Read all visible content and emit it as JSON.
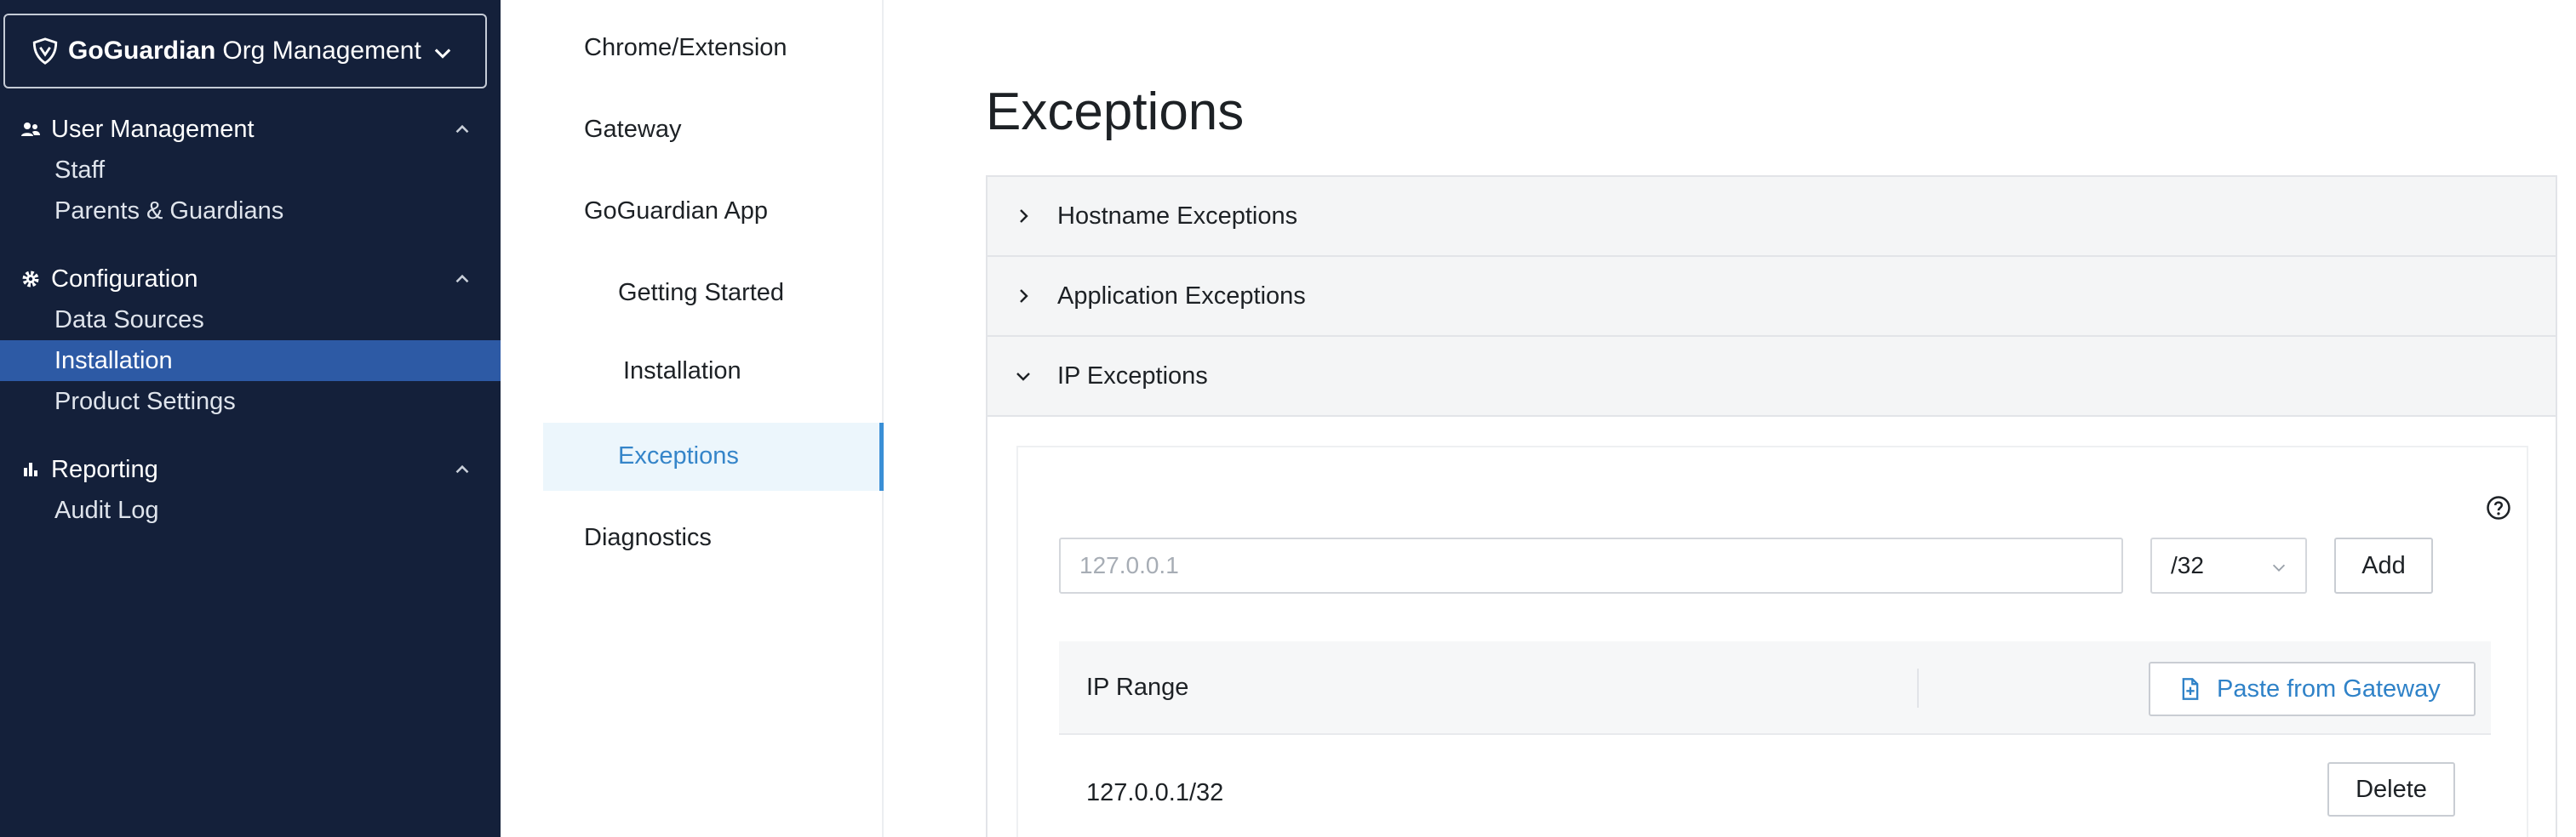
{
  "sidebar": {
    "org_brand": "GoGuardian",
    "org_name": "Org Management",
    "sections": [
      {
        "label": "User Management",
        "items": [
          "Staff",
          "Parents & Guardians"
        ]
      },
      {
        "label": "Configuration",
        "items": [
          "Data Sources",
          "Installation",
          "Product Settings"
        ],
        "active_item": "Installation"
      },
      {
        "label": "Reporting",
        "items": [
          "Audit Log"
        ]
      }
    ],
    "colors": {
      "background": "#14203a",
      "active": "#2d5aa5"
    }
  },
  "subnav": {
    "items": [
      "Chrome/Extension",
      "Gateway",
      "GoGuardian App",
      "Getting Started",
      "Installation",
      "Exceptions",
      "Diagnostics"
    ],
    "selected": "Exceptions",
    "accent": "#3a8fd6"
  },
  "main": {
    "title": "Exceptions",
    "accordions": [
      {
        "label": "Hostname Exceptions",
        "expanded": false
      },
      {
        "label": "Application Exceptions",
        "expanded": false
      },
      {
        "label": "IP Exceptions",
        "expanded": true
      }
    ],
    "ip": {
      "input_placeholder": "127.0.0.1",
      "input_value": "",
      "cidr_value": "/32",
      "add_label": "Add",
      "help_icon": "question-circle-icon",
      "table": {
        "column": "IP Range",
        "paste_label": "Paste from Gateway",
        "rows": [
          {
            "range": "127.0.0.1/32",
            "delete_label": "Delete"
          }
        ]
      }
    }
  }
}
